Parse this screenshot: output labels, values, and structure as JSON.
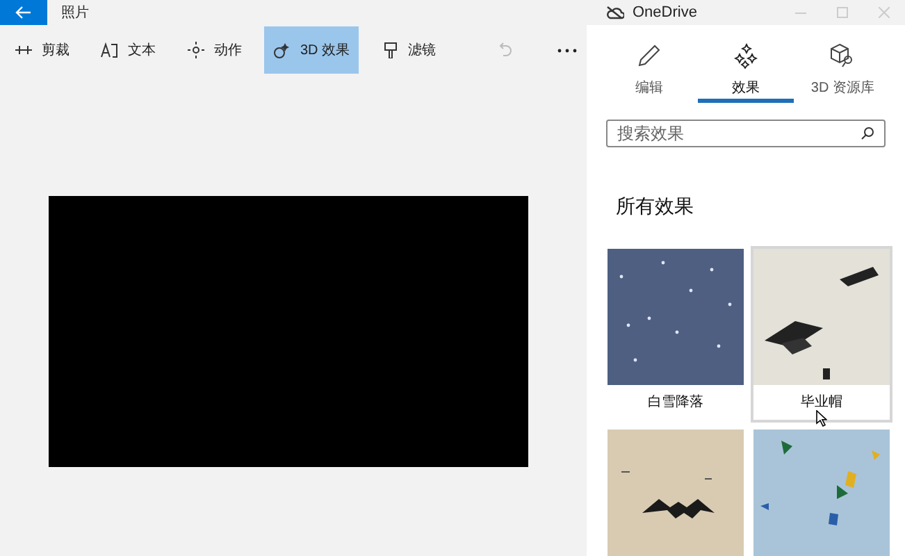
{
  "app": {
    "title": "照片"
  },
  "toolbar": [
    {
      "label": "剪裁",
      "selected": false
    },
    {
      "label": "文本",
      "selected": false
    },
    {
      "label": "动作",
      "selected": false
    },
    {
      "label": "3D 效果",
      "selected": true
    },
    {
      "label": "滤镜",
      "selected": false
    }
  ],
  "panel": {
    "title": "OneDrive",
    "tabs": [
      {
        "label": "编辑",
        "selected": false
      },
      {
        "label": "效果",
        "selected": true
      },
      {
        "label": "3D 资源库",
        "selected": false
      }
    ],
    "search": {
      "placeholder": "搜索效果"
    },
    "section_title": "所有效果",
    "effects": [
      {
        "label": "白雪降落",
        "hovered": false
      },
      {
        "label": "毕业帽",
        "hovered": true
      },
      {
        "hovered": false
      },
      {
        "hovered": false
      }
    ]
  }
}
